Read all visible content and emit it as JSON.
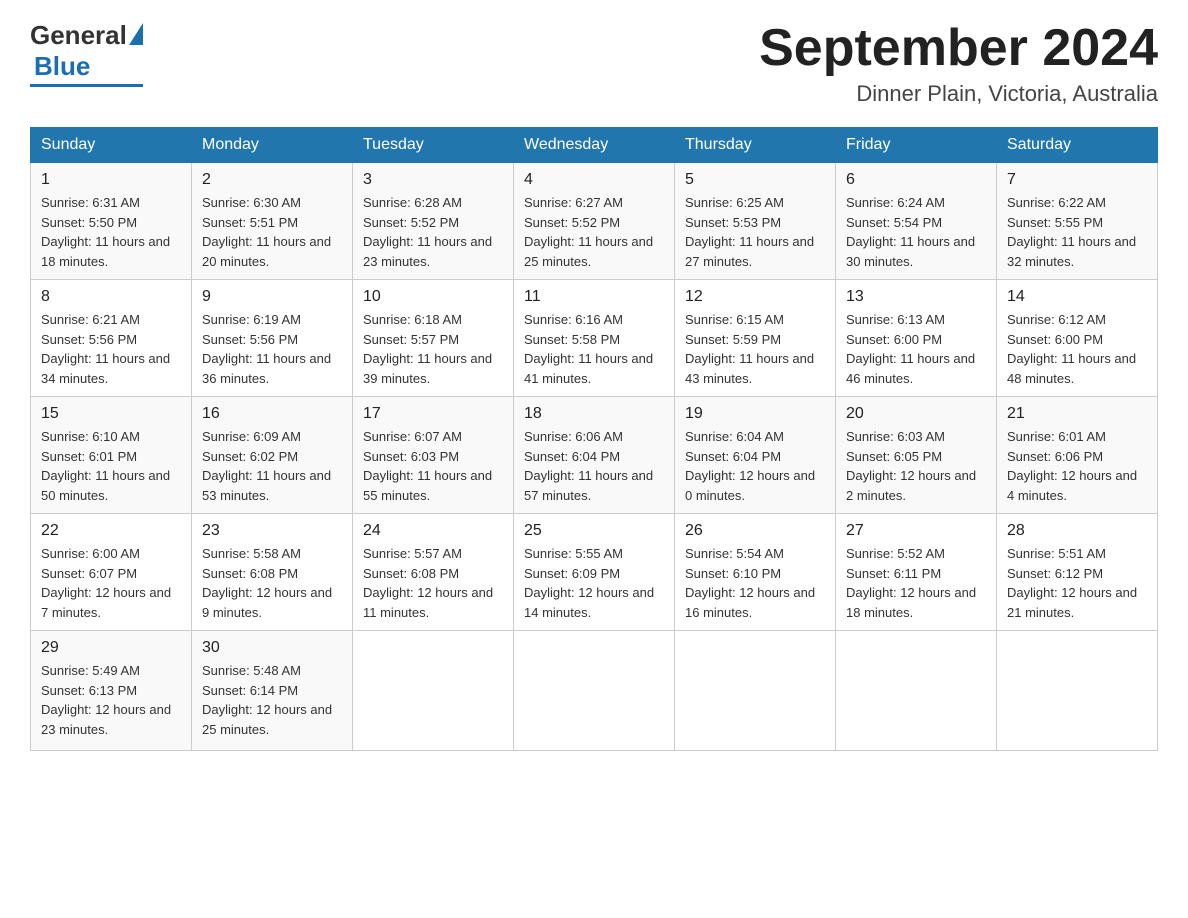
{
  "header": {
    "logo_general": "General",
    "logo_blue": "Blue",
    "month_title": "September 2024",
    "location": "Dinner Plain, Victoria, Australia"
  },
  "days_of_week": [
    "Sunday",
    "Monday",
    "Tuesday",
    "Wednesday",
    "Thursday",
    "Friday",
    "Saturday"
  ],
  "weeks": [
    [
      {
        "day": "1",
        "sunrise": "6:31 AM",
        "sunset": "5:50 PM",
        "daylight": "11 hours and 18 minutes."
      },
      {
        "day": "2",
        "sunrise": "6:30 AM",
        "sunset": "5:51 PM",
        "daylight": "11 hours and 20 minutes."
      },
      {
        "day": "3",
        "sunrise": "6:28 AM",
        "sunset": "5:52 PM",
        "daylight": "11 hours and 23 minutes."
      },
      {
        "day": "4",
        "sunrise": "6:27 AM",
        "sunset": "5:52 PM",
        "daylight": "11 hours and 25 minutes."
      },
      {
        "day": "5",
        "sunrise": "6:25 AM",
        "sunset": "5:53 PM",
        "daylight": "11 hours and 27 minutes."
      },
      {
        "day": "6",
        "sunrise": "6:24 AM",
        "sunset": "5:54 PM",
        "daylight": "11 hours and 30 minutes."
      },
      {
        "day": "7",
        "sunrise": "6:22 AM",
        "sunset": "5:55 PM",
        "daylight": "11 hours and 32 minutes."
      }
    ],
    [
      {
        "day": "8",
        "sunrise": "6:21 AM",
        "sunset": "5:56 PM",
        "daylight": "11 hours and 34 minutes."
      },
      {
        "day": "9",
        "sunrise": "6:19 AM",
        "sunset": "5:56 PM",
        "daylight": "11 hours and 36 minutes."
      },
      {
        "day": "10",
        "sunrise": "6:18 AM",
        "sunset": "5:57 PM",
        "daylight": "11 hours and 39 minutes."
      },
      {
        "day": "11",
        "sunrise": "6:16 AM",
        "sunset": "5:58 PM",
        "daylight": "11 hours and 41 minutes."
      },
      {
        "day": "12",
        "sunrise": "6:15 AM",
        "sunset": "5:59 PM",
        "daylight": "11 hours and 43 minutes."
      },
      {
        "day": "13",
        "sunrise": "6:13 AM",
        "sunset": "6:00 PM",
        "daylight": "11 hours and 46 minutes."
      },
      {
        "day": "14",
        "sunrise": "6:12 AM",
        "sunset": "6:00 PM",
        "daylight": "11 hours and 48 minutes."
      }
    ],
    [
      {
        "day": "15",
        "sunrise": "6:10 AM",
        "sunset": "6:01 PM",
        "daylight": "11 hours and 50 minutes."
      },
      {
        "day": "16",
        "sunrise": "6:09 AM",
        "sunset": "6:02 PM",
        "daylight": "11 hours and 53 minutes."
      },
      {
        "day": "17",
        "sunrise": "6:07 AM",
        "sunset": "6:03 PM",
        "daylight": "11 hours and 55 minutes."
      },
      {
        "day": "18",
        "sunrise": "6:06 AM",
        "sunset": "6:04 PM",
        "daylight": "11 hours and 57 minutes."
      },
      {
        "day": "19",
        "sunrise": "6:04 AM",
        "sunset": "6:04 PM",
        "daylight": "12 hours and 0 minutes."
      },
      {
        "day": "20",
        "sunrise": "6:03 AM",
        "sunset": "6:05 PM",
        "daylight": "12 hours and 2 minutes."
      },
      {
        "day": "21",
        "sunrise": "6:01 AM",
        "sunset": "6:06 PM",
        "daylight": "12 hours and 4 minutes."
      }
    ],
    [
      {
        "day": "22",
        "sunrise": "6:00 AM",
        "sunset": "6:07 PM",
        "daylight": "12 hours and 7 minutes."
      },
      {
        "day": "23",
        "sunrise": "5:58 AM",
        "sunset": "6:08 PM",
        "daylight": "12 hours and 9 minutes."
      },
      {
        "day": "24",
        "sunrise": "5:57 AM",
        "sunset": "6:08 PM",
        "daylight": "12 hours and 11 minutes."
      },
      {
        "day": "25",
        "sunrise": "5:55 AM",
        "sunset": "6:09 PM",
        "daylight": "12 hours and 14 minutes."
      },
      {
        "day": "26",
        "sunrise": "5:54 AM",
        "sunset": "6:10 PM",
        "daylight": "12 hours and 16 minutes."
      },
      {
        "day": "27",
        "sunrise": "5:52 AM",
        "sunset": "6:11 PM",
        "daylight": "12 hours and 18 minutes."
      },
      {
        "day": "28",
        "sunrise": "5:51 AM",
        "sunset": "6:12 PM",
        "daylight": "12 hours and 21 minutes."
      }
    ],
    [
      {
        "day": "29",
        "sunrise": "5:49 AM",
        "sunset": "6:13 PM",
        "daylight": "12 hours and 23 minutes."
      },
      {
        "day": "30",
        "sunrise": "5:48 AM",
        "sunset": "6:14 PM",
        "daylight": "12 hours and 25 minutes."
      },
      null,
      null,
      null,
      null,
      null
    ]
  ],
  "labels": {
    "sunrise": "Sunrise:",
    "sunset": "Sunset:",
    "daylight": "Daylight:"
  }
}
